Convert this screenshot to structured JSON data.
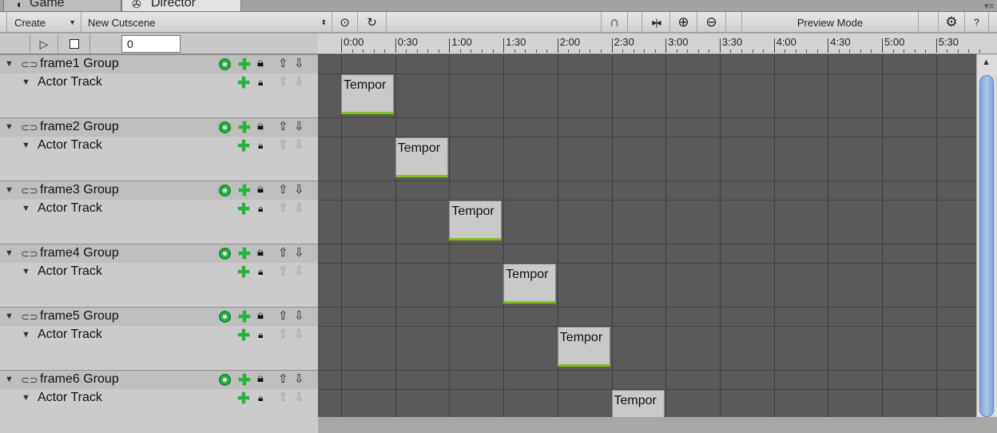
{
  "tabs": {
    "game": {
      "label": "Game",
      "icon": "pacman-icon"
    },
    "director": {
      "label": "Director",
      "icon": "director-icon"
    }
  },
  "toolbar": {
    "create_label": "Create",
    "cutscene_label": "New Cutscene",
    "preview_mode_label": "Preview Mode",
    "help_label": "?"
  },
  "playback": {
    "current_frame": "0"
  },
  "ruler": {
    "labels": [
      "0:00",
      "0:30",
      "1:00",
      "1:30",
      "2:00",
      "2:30",
      "3:00",
      "3:30",
      "4:00",
      "4:30",
      "5:00",
      "5:30"
    ]
  },
  "groups": [
    {
      "name": "frame1 Group",
      "track": "Actor Track",
      "clip_label": "Tempor",
      "clip_start": "0:00"
    },
    {
      "name": "frame2 Group",
      "track": "Actor Track",
      "clip_label": "Tempor",
      "clip_start": "0:30"
    },
    {
      "name": "frame3 Group",
      "track": "Actor Track",
      "clip_label": "Tempor",
      "clip_start": "1:00"
    },
    {
      "name": "frame4 Group",
      "track": "Actor Track",
      "clip_label": "Tempor",
      "clip_start": "1:30"
    },
    {
      "name": "frame5 Group",
      "track": "Actor Track",
      "clip_label": "Tempor",
      "clip_start": "2:00"
    },
    {
      "name": "frame6 Group",
      "track": "Actor Track",
      "clip_label": "Tempor",
      "clip_start": "2:30"
    }
  ],
  "colors": {
    "timeline_bg": "#5a5a5a",
    "clip_bg": "#c9c9c9",
    "clip_accent": "#7fbf1a",
    "add_green": "#27b43a",
    "scroll_thumb": "#8fb2e0"
  }
}
